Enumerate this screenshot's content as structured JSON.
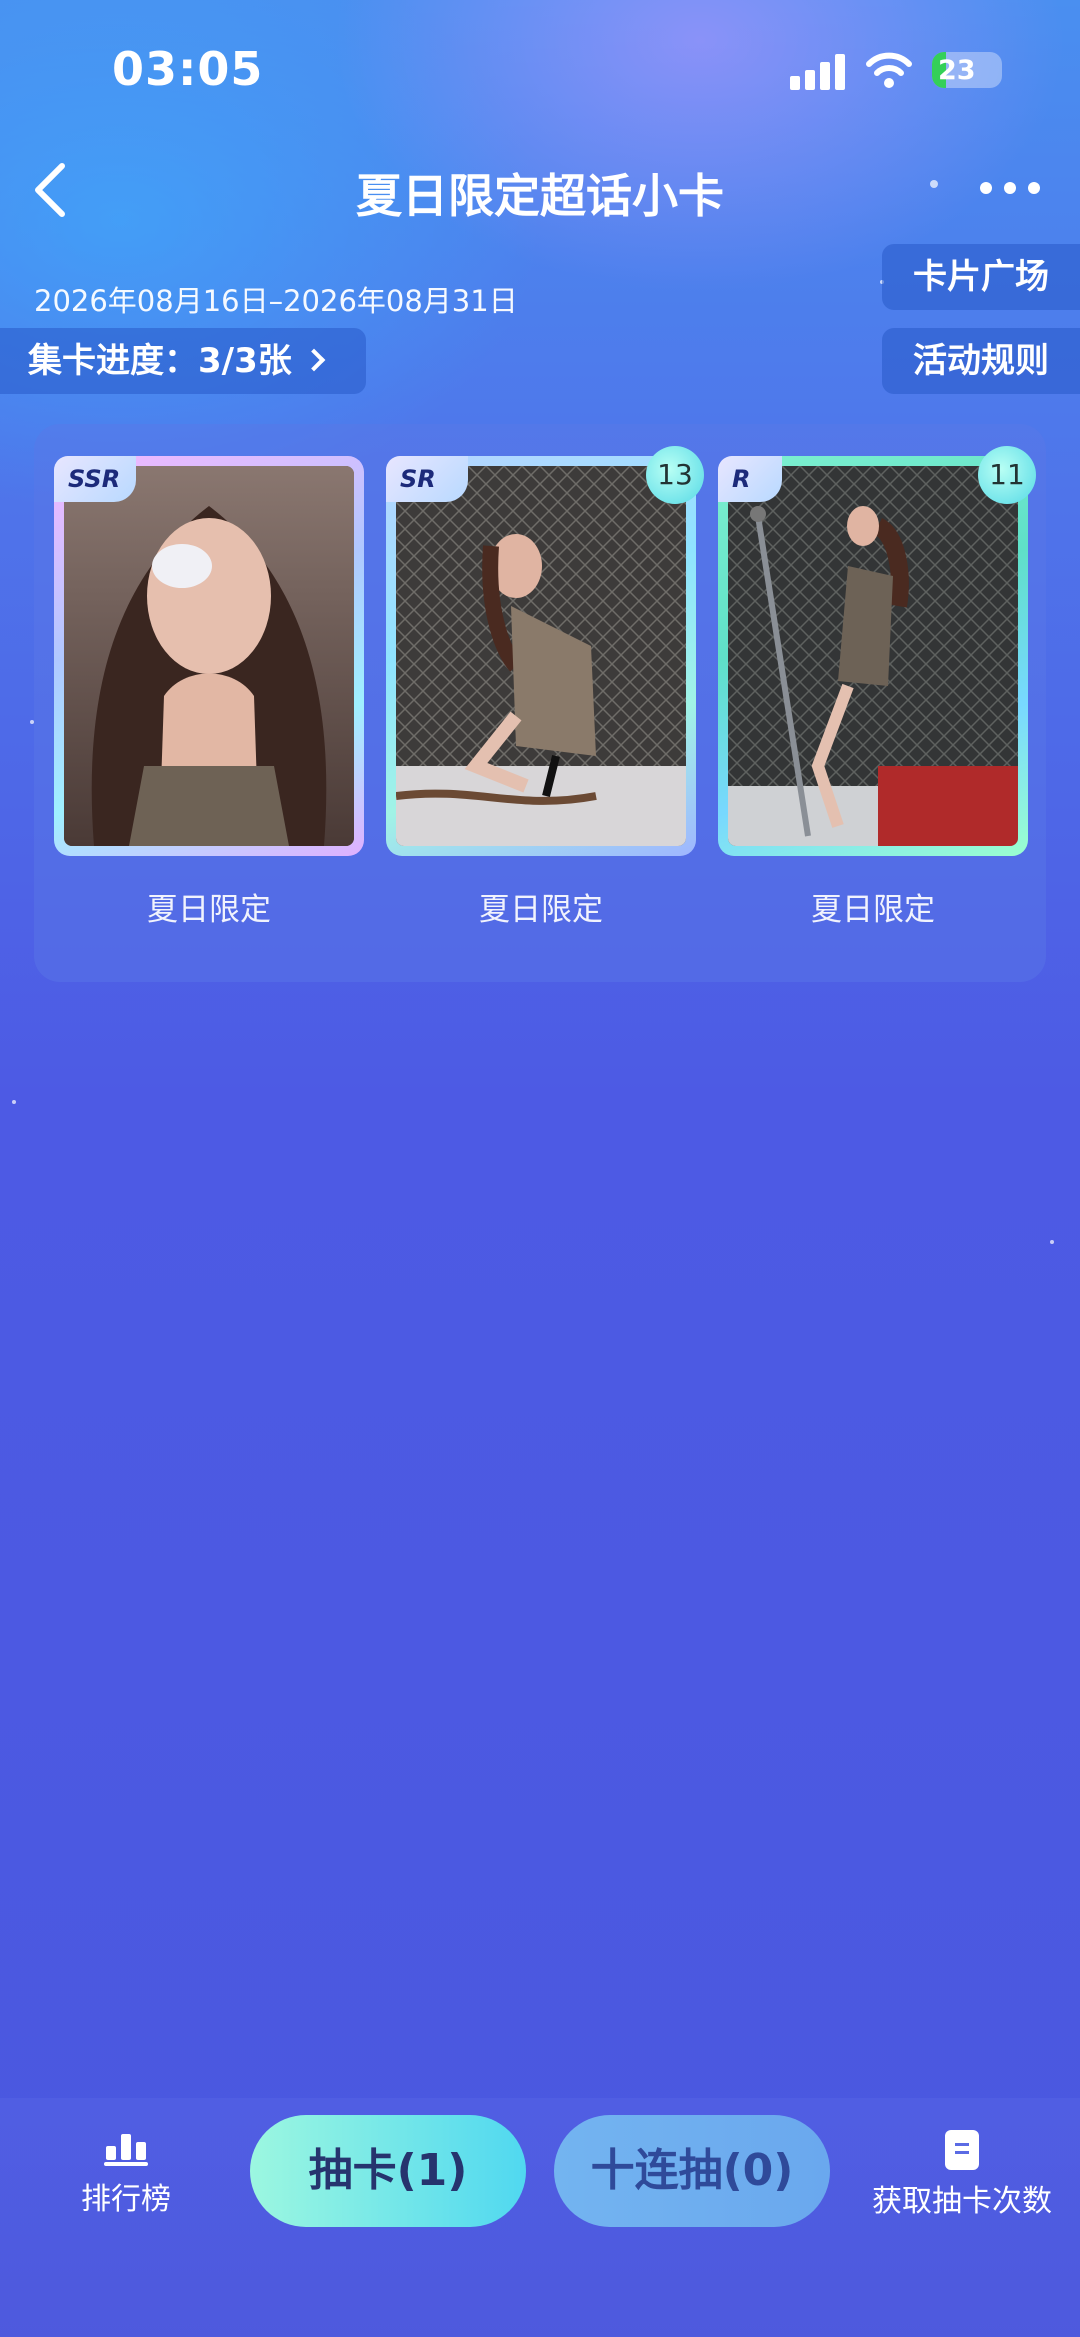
{
  "status_bar": {
    "time": "03:05",
    "battery": "23"
  },
  "nav": {
    "title": "夏日限定超话小卡"
  },
  "event": {
    "date_range": "2026年08月16日–2026年08月31日",
    "progress_label": "集卡进度：3/3张",
    "card_square_label": "卡片广场",
    "rules_label": "活动规则"
  },
  "cards": [
    {
      "rarity": "SSR",
      "count": "",
      "label": "夏日限定"
    },
    {
      "rarity": "SR",
      "count": "13",
      "label": "夏日限定"
    },
    {
      "rarity": "R",
      "count": "11",
      "label": "夏日限定"
    }
  ],
  "bottom": {
    "ranking_label": "排行榜",
    "draw_label": "抽卡(1)",
    "draw10_label": "十连抽(0)",
    "get_draws_label": "获取抽卡次数"
  },
  "colors": {
    "accent_cyan": "#50d8f0",
    "background": "#4d5ae4",
    "rarity_text": "#1c2a7a"
  },
  "icons": [
    "back-icon",
    "more-icon",
    "signal-icon",
    "wifi-icon",
    "battery-icon",
    "ranking-icon",
    "document-icon",
    "chevron-right-icon"
  ]
}
